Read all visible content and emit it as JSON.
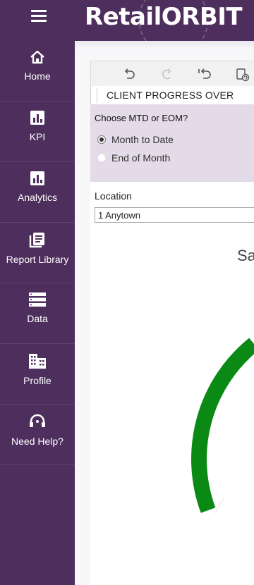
{
  "header": {
    "brand": "RetailORBIT",
    "menu_icon": "hamburger-menu-icon"
  },
  "sidebar": {
    "items": [
      {
        "label": "Home",
        "icon": "home-icon"
      },
      {
        "label": "KPI",
        "icon": "bar-chart-icon"
      },
      {
        "label": "Analytics",
        "icon": "bar-chart-icon"
      },
      {
        "label": "Report Library",
        "icon": "report-stack-icon"
      },
      {
        "label": "Data",
        "icon": "database-list-icon"
      },
      {
        "label": "Profile",
        "icon": "building-icon"
      },
      {
        "label": "Need Help?",
        "icon": "headset-icon"
      }
    ]
  },
  "toolbar": {
    "buttons": [
      "undo-icon",
      "redo-icon",
      "revert-icon",
      "refresh-icon"
    ]
  },
  "tab": {
    "label": "CLIENT PROGRESS OVER"
  },
  "filter": {
    "title": "Choose MTD or EOM?",
    "options": [
      {
        "label": "Month to Date",
        "selected": true
      },
      {
        "label": "End of Month",
        "selected": false
      }
    ]
  },
  "location": {
    "label": "Location",
    "value": "1 Anytown"
  },
  "chart": {
    "title_partial": "Sa",
    "gauge_color": "#0a8a14"
  },
  "colors": {
    "sidebar": "#4d2e5c",
    "filter_panel": "#e4dbe8",
    "gauge": "#0a8a14"
  }
}
